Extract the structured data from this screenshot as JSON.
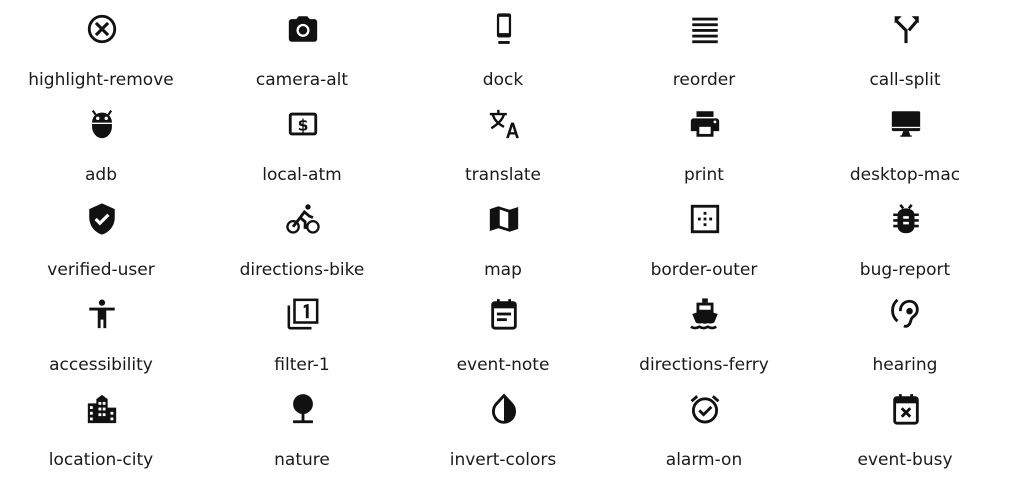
{
  "icons": [
    {
      "label": "highlight-remove",
      "icon": "highlight-remove-icon"
    },
    {
      "label": "camera-alt",
      "icon": "camera-alt-icon"
    },
    {
      "label": "dock",
      "icon": "dock-icon"
    },
    {
      "label": "reorder",
      "icon": "reorder-icon"
    },
    {
      "label": "call-split",
      "icon": "call-split-icon"
    },
    {
      "label": "adb",
      "icon": "adb-icon"
    },
    {
      "label": "local-atm",
      "icon": "local-atm-icon"
    },
    {
      "label": "translate",
      "icon": "translate-icon"
    },
    {
      "label": "print",
      "icon": "print-icon"
    },
    {
      "label": "desktop-mac",
      "icon": "desktop-mac-icon"
    },
    {
      "label": "verified-user",
      "icon": "verified-user-icon"
    },
    {
      "label": "directions-bike",
      "icon": "directions-bike-icon"
    },
    {
      "label": "map",
      "icon": "map-icon"
    },
    {
      "label": "border-outer",
      "icon": "border-outer-icon"
    },
    {
      "label": "bug-report",
      "icon": "bug-report-icon"
    },
    {
      "label": "accessibility",
      "icon": "accessibility-icon"
    },
    {
      "label": "filter-1",
      "icon": "filter-1-icon"
    },
    {
      "label": "event-note",
      "icon": "event-note-icon"
    },
    {
      "label": "directions-ferry",
      "icon": "directions-ferry-icon"
    },
    {
      "label": "hearing",
      "icon": "hearing-icon"
    },
    {
      "label": "location-city",
      "icon": "location-city-icon"
    },
    {
      "label": "nature",
      "icon": "nature-icon"
    },
    {
      "label": "invert-colors",
      "icon": "invert-colors-icon"
    },
    {
      "label": "alarm-on",
      "icon": "alarm-on-icon"
    },
    {
      "label": "event-busy",
      "icon": "event-busy-icon"
    }
  ],
  "colors": {
    "icon": "#111111",
    "text": "#1a1a1a",
    "background": "#ffffff"
  }
}
